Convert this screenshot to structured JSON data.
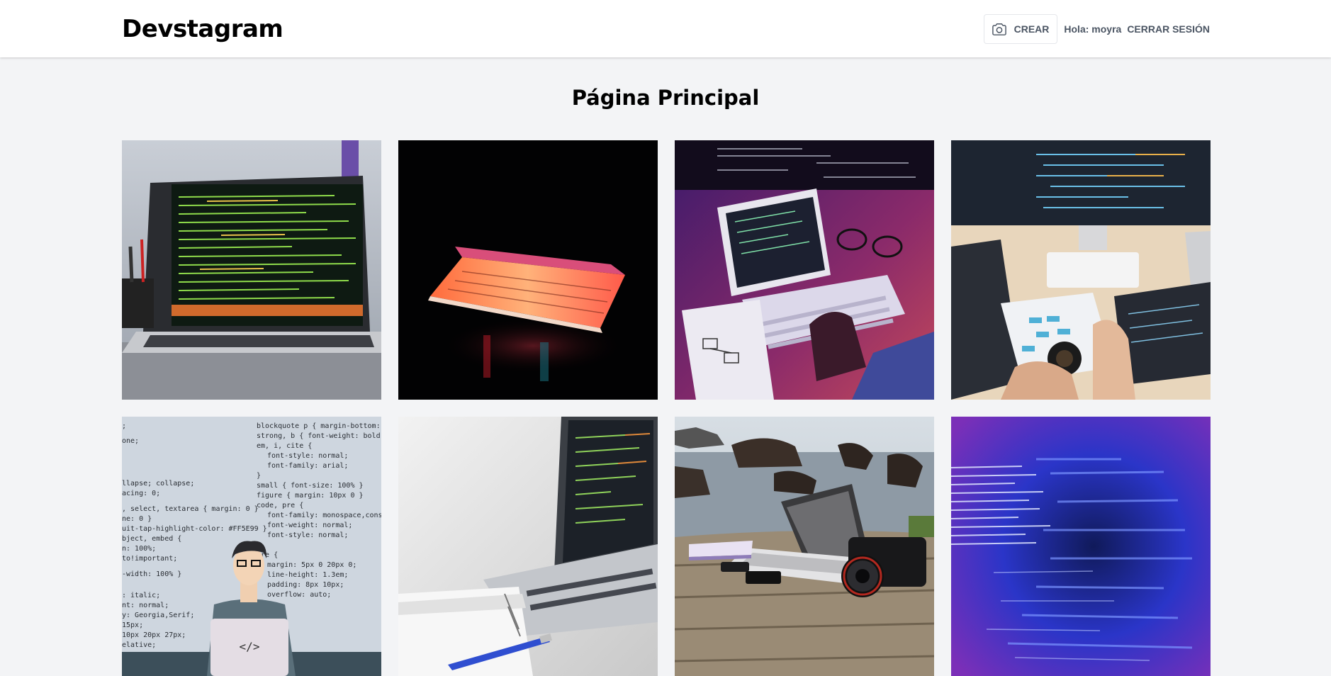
{
  "header": {
    "logo": "Devstagram",
    "create_label": "CREAR",
    "greeting": "Hola: moyra",
    "logout_label": "CERRAR SESIÓN"
  },
  "main": {
    "title": "Página Principal"
  },
  "posts": [
    {
      "id": "post-1",
      "subject": "laptop with code on screen"
    },
    {
      "id": "post-2",
      "subject": "glowing laptop in dark"
    },
    {
      "id": "post-3",
      "subject": "tablet and keyboard with purple light"
    },
    {
      "id": "post-4",
      "subject": "desk with monitor from above"
    },
    {
      "id": "post-5",
      "subject": "developer illustration with css code"
    },
    {
      "id": "post-6",
      "subject": "laptop and notebook with pen"
    },
    {
      "id": "post-7",
      "subject": "laptop and camera on wooden table by sea"
    },
    {
      "id": "post-8",
      "subject": "blurred blue code"
    }
  ],
  "colors": {
    "background": "#f3f4f6",
    "header_bg": "#ffffff",
    "text_muted": "#4b5563"
  }
}
